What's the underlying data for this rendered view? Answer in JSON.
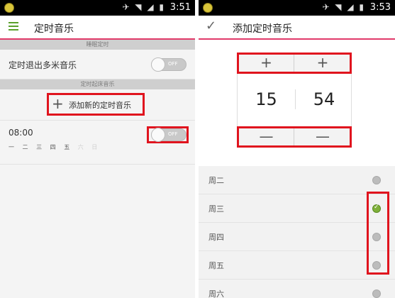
{
  "left": {
    "status_time": "3:51",
    "title": "定时音乐",
    "sleep_section": "睡眠定时",
    "quit_label": "定时退出多米音乐",
    "quit_toggle": "OFF",
    "alarm_section": "定时起床音乐",
    "add_label": "添加新的定时音乐",
    "alarm": {
      "time": "08:00",
      "days": [
        "一",
        "二",
        "三",
        "四",
        "五",
        "六",
        "日"
      ],
      "toggle": "OFF"
    }
  },
  "right": {
    "status_time": "3:53",
    "title": "添加定时音乐",
    "picker": {
      "plus": "+",
      "minus": "—",
      "hour": "15",
      "minute": "54"
    },
    "days": [
      {
        "label": "周二",
        "checked": false
      },
      {
        "label": "周三",
        "checked": true
      },
      {
        "label": "周四",
        "checked": false
      },
      {
        "label": "周五",
        "checked": false
      },
      {
        "label": "周六",
        "checked": false
      }
    ]
  },
  "status_icons": "✈ ◥ ◢ ▮",
  "colors": {
    "accent": "#e13a6a",
    "highlight": "#e0141e",
    "menu_green": "#5aa02c",
    "check_green": "#7fb03a"
  }
}
